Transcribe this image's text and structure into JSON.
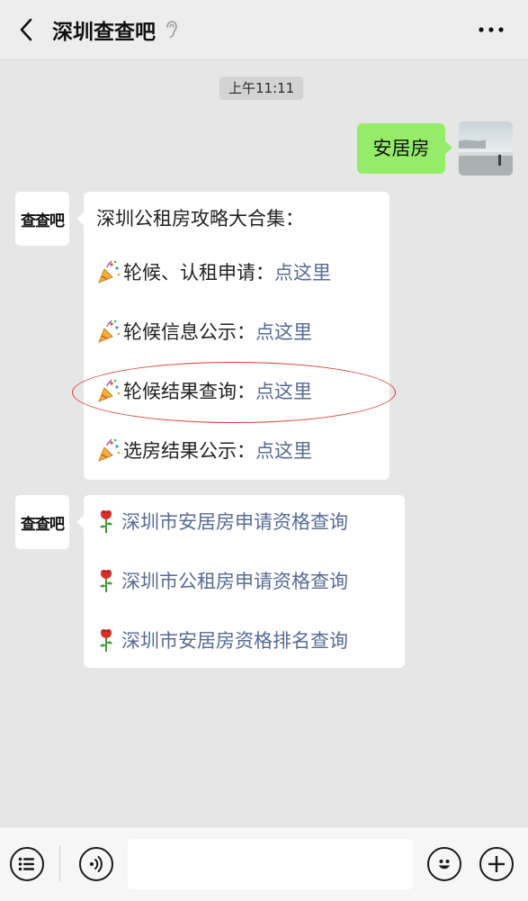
{
  "header": {
    "title": "深圳查查吧"
  },
  "chat": {
    "timestamp": "上午11:11",
    "outgoing": {
      "text": "安居房"
    },
    "bot_logo": "查查吧",
    "msg1": {
      "intro": "深圳公租房攻略大合集：",
      "items": [
        {
          "label": "轮候、认租申请：",
          "link": "点这里"
        },
        {
          "label": "轮候信息公示：",
          "link": "点这里"
        },
        {
          "label": "轮候结果查询：",
          "link": "点这里"
        },
        {
          "label": "选房结果公示：",
          "link": "点这里"
        }
      ]
    },
    "msg2": {
      "links": [
        "深圳市安居房申请资格查询",
        "深圳市公租房申请资格查询",
        "深圳市安居房资格排名查询"
      ]
    }
  },
  "colors": {
    "bubble_out": "#95ec69",
    "link": "#576b95",
    "highlight": "#d83a32"
  },
  "icons": {
    "back": "chevron-left-icon",
    "ear": "ear-icon",
    "more": "more-icon",
    "party": "party-popper-icon",
    "rose": "rose-icon",
    "menu": "menu-list-icon",
    "voice": "voice-icon",
    "emoji": "emoji-icon",
    "add": "plus-icon"
  }
}
